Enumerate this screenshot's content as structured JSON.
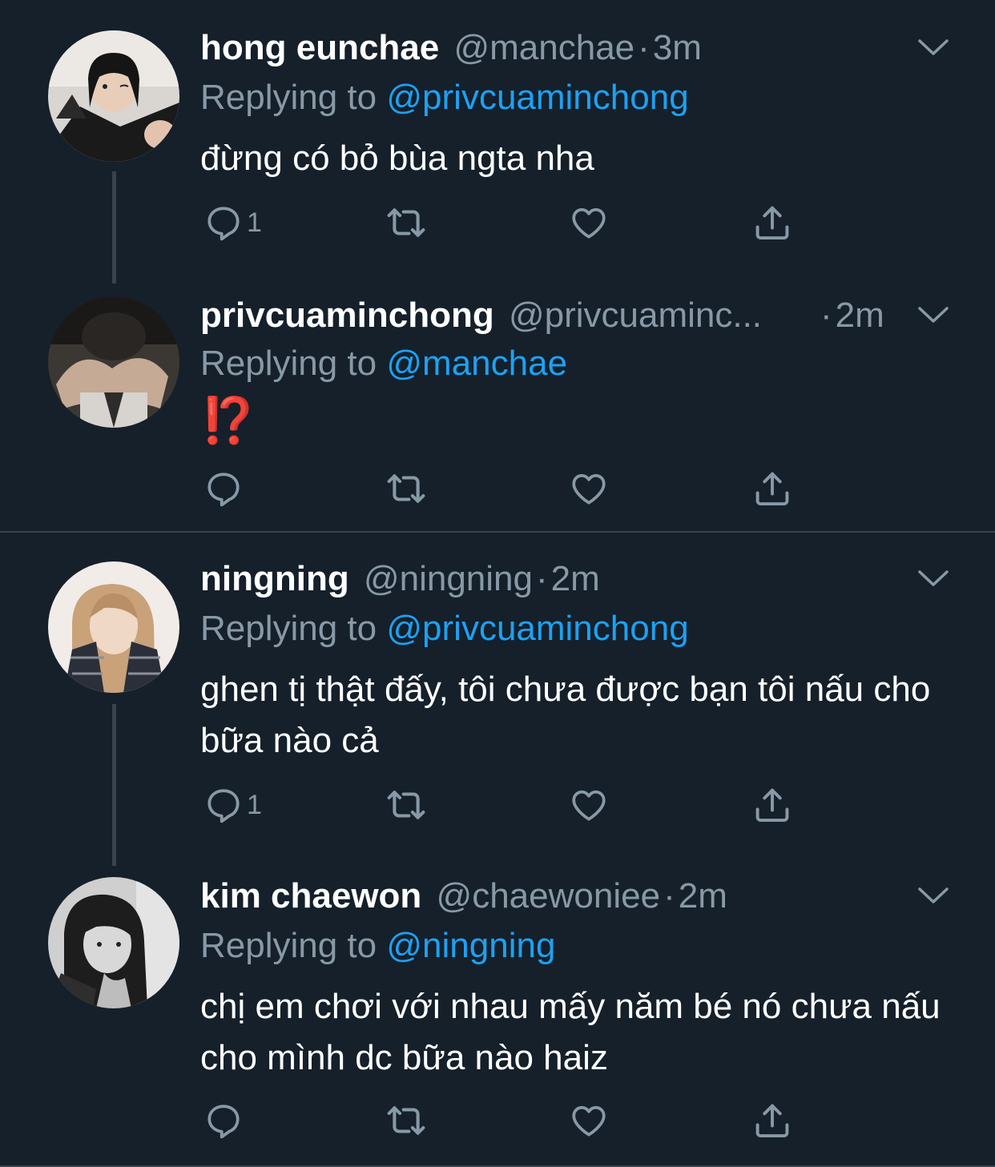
{
  "colors": {
    "background": "#15202b",
    "primary_text": "#ffffff",
    "secondary_text": "#8899a6",
    "link": "#1da1f2",
    "divider": "#38444d"
  },
  "tweets": [
    {
      "name": "hong eunchae",
      "handle": "@manchae",
      "time": "3m",
      "replying_prefix": "Replying to",
      "replying_to": "@privcuaminchong",
      "text": "đừng có bỏ bùa ngta nha",
      "reply_count": "1"
    },
    {
      "name": "privcuaminchong",
      "handle": "@privcuaminc...",
      "time": "2m",
      "replying_prefix": "Replying to",
      "replying_to": "@manchae",
      "text": "⁉️",
      "reply_count": ""
    },
    {
      "name": "ningning",
      "handle": "@ningning",
      "time": "2m",
      "replying_prefix": "Replying to",
      "replying_to": "@privcuaminchong",
      "text": "ghen tị thật đấy, tôi chưa được bạn tôi nấu cho bữa nào cả",
      "reply_count": "1"
    },
    {
      "name": "kim chaewon",
      "handle": "@chaewoniee",
      "time": "2m",
      "replying_prefix": "Replying to",
      "replying_to": "@ningning",
      "text": "chị em chơi với nhau mấy năm bé nó chưa nấu cho mình dc bữa nào haiz",
      "reply_count": ""
    }
  ],
  "separator": "·",
  "icons": {
    "reply": "reply-icon",
    "retweet": "retweet-icon",
    "like": "heart-icon",
    "share": "share-icon",
    "more": "chevron-down-icon"
  }
}
